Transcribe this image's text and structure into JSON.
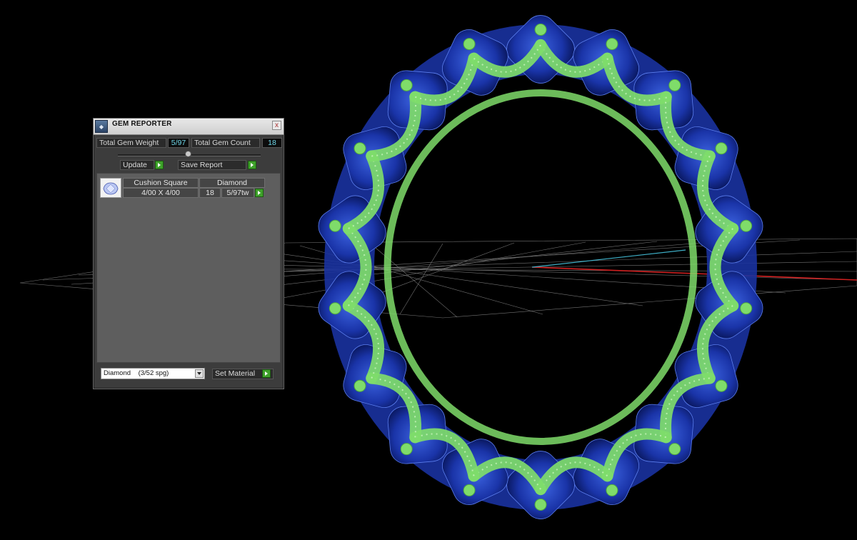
{
  "window": {
    "title": "GEM REPORTER",
    "close_glyph": "x",
    "icon": "gem-reporter-app-icon"
  },
  "stats": {
    "weight_label": "Total Gem Weight",
    "weight_value": "5/97",
    "count_label": "Total Gem Count",
    "count_value": "18"
  },
  "buttons": {
    "update": "Update",
    "save_report": "Save Report",
    "set_material": "Set Material"
  },
  "gem_table": {
    "rows": [
      {
        "shape": "Cushion Square",
        "material": "Diamond",
        "size": "4/00 X 4/00",
        "count": "18",
        "weight": "5/97tw",
        "icon": "cushion-gem-icon"
      }
    ]
  },
  "material_select": {
    "value": "Diamond    (3/52 spg)"
  },
  "colors": {
    "accent_go": "#3ea12a",
    "value_text": "#6fd6e8",
    "prong_green": "#7fdc6a",
    "gem_blue": "#1e3fb5",
    "axis_red": "#d02020",
    "axis_cyan": "#3fb0c8"
  }
}
